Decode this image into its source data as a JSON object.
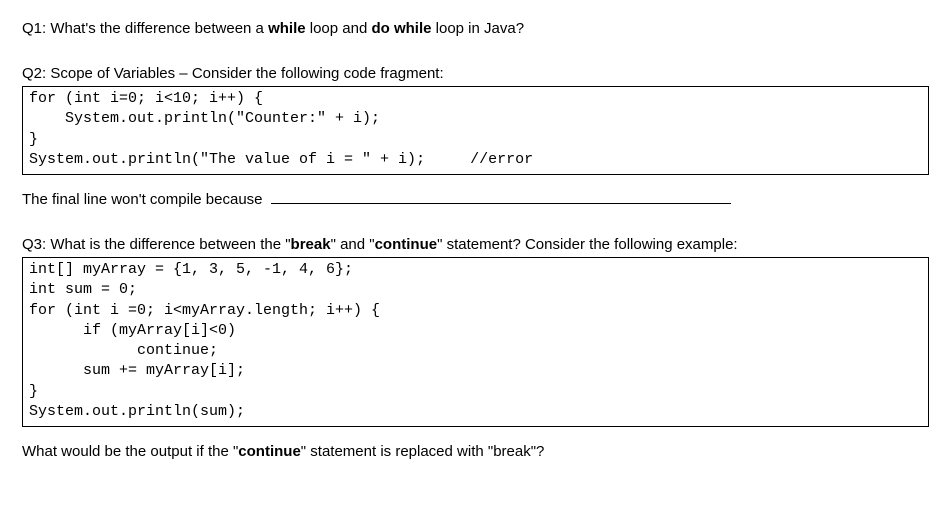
{
  "q1": {
    "prefix": "Q1: What's the difference between a ",
    "bold1": "while",
    "mid1": " loop and ",
    "bold2": "do while",
    "suffix": " loop in Java?"
  },
  "q2": {
    "heading": "Q2: Scope of Variables – Consider the following code fragment:",
    "code": "for (int i=0; i<10; i++) {\n    System.out.println(\"Counter:\" + i);\n}\nSystem.out.println(\"The value of i = \" + i);     //error",
    "followup": "The final line won't compile because "
  },
  "q3": {
    "pre1": "Q3: What is the difference between the \"",
    "bold1": "break",
    "mid1": "\" and \"",
    "bold2": "continue",
    "post1": "\" statement? Consider the following example:",
    "code": "int[] myArray = {1, 3, 5, -1, 4, 6};\nint sum = 0;\nfor (int i =0; i<myArray.length; i++) {\n      if (myArray[i]<0)\n            continue;\n      sum += myArray[i];\n}\nSystem.out.println(sum);",
    "followup_pre": "What would be the output if the \"",
    "followup_bold": "continue",
    "followup_post": "\" statement is replaced with \"break\"?"
  }
}
